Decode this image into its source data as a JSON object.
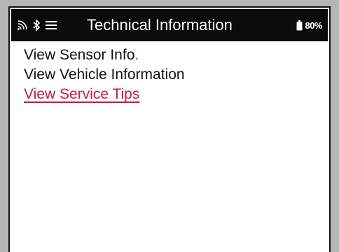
{
  "header": {
    "title": "Technical Information",
    "battery": "80%",
    "icons": [
      "signal-icon",
      "bluetooth-icon",
      "menu-icon",
      "battery-icon"
    ]
  },
  "menu": {
    "items": [
      {
        "label": "View Sensor Info",
        "suffix": "."
      },
      {
        "label": "View Vehicle Information",
        "suffix": ""
      },
      {
        "label": "View Service Tips",
        "suffix": ""
      }
    ],
    "selected_index": 2
  },
  "colors": {
    "titlebar_background": "#0b0b0b",
    "selected_item": "#c8193f",
    "frame_background": "#b5b5b5"
  }
}
